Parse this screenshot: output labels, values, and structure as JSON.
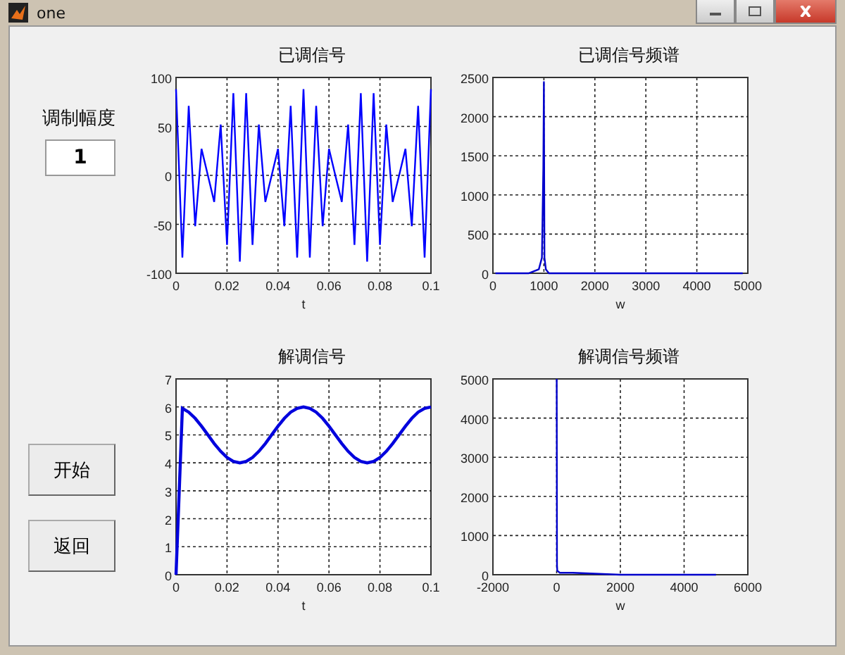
{
  "window": {
    "title": "one"
  },
  "controls": {
    "amplitude_label": "调制幅度",
    "amplitude_value": "1",
    "buttons": [
      "开始",
      "返回"
    ]
  },
  "plots": [
    {
      "chart_data": {
        "type": "line",
        "title": "已调信号",
        "xlabel": "t",
        "grid": true,
        "x": [
          0,
          0.0025,
          0.005,
          0.0075,
          0.01,
          0.0125,
          0.015,
          0.0175,
          0.02,
          0.0225,
          0.025,
          0.0275,
          0.03,
          0.0325,
          0.035,
          0.0375,
          0.04,
          0.0425,
          0.045,
          0.0475,
          0.05,
          0.0525,
          0.055,
          0.0575,
          0.06,
          0.0625,
          0.065,
          0.0675,
          0.07,
          0.0725,
          0.075,
          0.0775,
          0.08,
          0.0825,
          0.085,
          0.0875,
          0.09,
          0.0925,
          0.095,
          0.0975,
          0.1
        ],
        "xlim": [
          0,
          0.1
        ],
        "ylim": [
          -100,
          100
        ],
        "xticks": [
          0,
          0.02,
          0.04,
          0.06,
          0.08,
          0.1
        ],
        "yticks": [
          -100,
          -50,
          0,
          50,
          100
        ],
        "series": [
          {
            "color": "#0000ff",
            "values": [
              88,
              -84,
              71,
              -52,
              27,
              0,
              -27,
              52,
              -71,
              84,
              -88,
              84,
              -71,
              52,
              -27,
              0,
              27,
              -52,
              71,
              -84,
              88,
              -84,
              71,
              -52,
              27,
              0,
              -27,
              52,
              -71,
              84,
              -88,
              84,
              -71,
              52,
              -27,
              0,
              27,
              -52,
              71,
              -84,
              88
            ]
          }
        ]
      }
    },
    {
      "chart_data": {
        "type": "line",
        "title": "已调信号频谱",
        "xlabel": "w",
        "grid": true,
        "x": [
          50,
          700,
          900,
          960,
          990,
          1000,
          1010,
          1040,
          1100,
          1300,
          4900
        ],
        "xlim": [
          0,
          5000
        ],
        "ylim": [
          0,
          2500
        ],
        "xticks": [
          0,
          1000,
          2000,
          3000,
          4000,
          5000
        ],
        "yticks": [
          0,
          500,
          1000,
          1500,
          2000,
          2500
        ],
        "series": [
          {
            "color": "#0000cc",
            "values": [
              0,
              0,
              50,
              200,
              1350,
              2450,
              200,
              50,
              0,
              0,
              0
            ]
          }
        ]
      }
    },
    {
      "chart_data": {
        "type": "line",
        "title": "解调信号",
        "xlabel": "t",
        "grid": true,
        "x": [
          0,
          0.0025,
          0.005,
          0.0075,
          0.01,
          0.0125,
          0.015,
          0.0175,
          0.02,
          0.0225,
          0.025,
          0.0275,
          0.03,
          0.0325,
          0.035,
          0.0375,
          0.04,
          0.0425,
          0.045,
          0.0475,
          0.05,
          0.0525,
          0.055,
          0.0575,
          0.06,
          0.0625,
          0.065,
          0.0675,
          0.07,
          0.0725,
          0.075,
          0.0775,
          0.08,
          0.0825,
          0.085,
          0.0875,
          0.09,
          0.0925,
          0.095,
          0.0975,
          0.1
        ],
        "xlim": [
          0,
          0.1
        ],
        "ylim": [
          0,
          7
        ],
        "xticks": [
          0,
          0.02,
          0.04,
          0.06,
          0.08,
          0.1
        ],
        "yticks": [
          0,
          1,
          2,
          3,
          4,
          5,
          6,
          7
        ],
        "series": [
          {
            "color": "#0000dd",
            "values": [
              0,
              5.95,
              5.81,
              5.59,
              5.31,
              5,
              4.69,
              4.41,
              4.19,
              4.05,
              4,
              4.05,
              4.19,
              4.41,
              4.69,
              5,
              5.31,
              5.59,
              5.81,
              5.95,
              6,
              5.95,
              5.81,
              5.59,
              5.31,
              5,
              4.69,
              4.41,
              4.19,
              4.05,
              4,
              4.05,
              4.19,
              4.41,
              4.69,
              5,
              5.31,
              5.59,
              5.81,
              5.95,
              6
            ]
          }
        ]
      }
    },
    {
      "chart_data": {
        "type": "line",
        "title": "解调信号频谱",
        "xlabel": "w",
        "grid": true,
        "x": [
          0,
          10,
          20,
          100,
          500,
          2000,
          5000
        ],
        "xlim": [
          -2000,
          6000
        ],
        "ylim": [
          0,
          5000
        ],
        "xticks": [
          -2000,
          0,
          2000,
          4000,
          6000
        ],
        "yticks": [
          0,
          1000,
          2000,
          3000,
          4000,
          5000
        ],
        "series": [
          {
            "color": "#0000cc",
            "values": [
              5000,
              250,
              100,
              50,
              50,
              0,
              0
            ]
          }
        ]
      }
    }
  ]
}
